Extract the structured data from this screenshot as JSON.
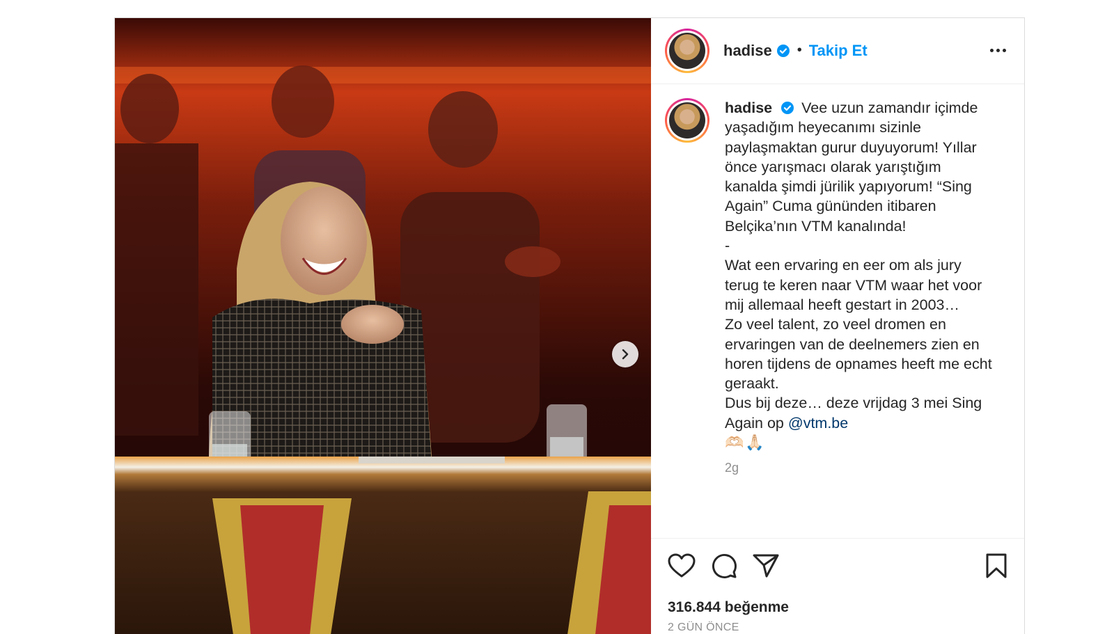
{
  "header": {
    "username": "hadise",
    "separator": "•",
    "follow_label": "Takip Et",
    "more_icon": "more-horizontal-icon"
  },
  "caption": {
    "username": "hadise",
    "lines_tr": "Vee uzun zamandır içimde yaşadığım heyecanımı sizinle paylaşmaktan gurur duyuyorum! Yıllar önce yarışmacı olarak yarıştığım kanalda şimdi jürilik yapıyorum! “Sing Again” Cuma gününden itibaren Belçika’nın VTM kanalında!",
    "dash": "-",
    "para_nl_1": "Wat een ervaring en eer om als jury terug te keren naar VTM waar het voor mij allemaal heeft gestart in 2003…",
    "para_nl_2": "Zo veel talent, zo veel dromen en ervaringen van de deelnemers zien en horen tijdens de opnames heeft me echt geraakt.",
    "para_nl_3": "Dus bij deze… deze vrijdag 3 mei Sing Again op",
    "mention": "@vtm.be",
    "emojis": "🫶🏻🙏🏻",
    "age": "2g"
  },
  "actions": {
    "like_icon": "heart-icon",
    "comment_icon": "comment-icon",
    "share_icon": "paper-plane-icon",
    "save_icon": "bookmark-icon"
  },
  "likes": "316.844 beğenme",
  "posted": "2 GÜN ÖNCE",
  "colors": {
    "accent_blue": "#0095f6",
    "mention_blue": "#00376b",
    "text": "#262626",
    "muted": "#8e8e8e"
  }
}
